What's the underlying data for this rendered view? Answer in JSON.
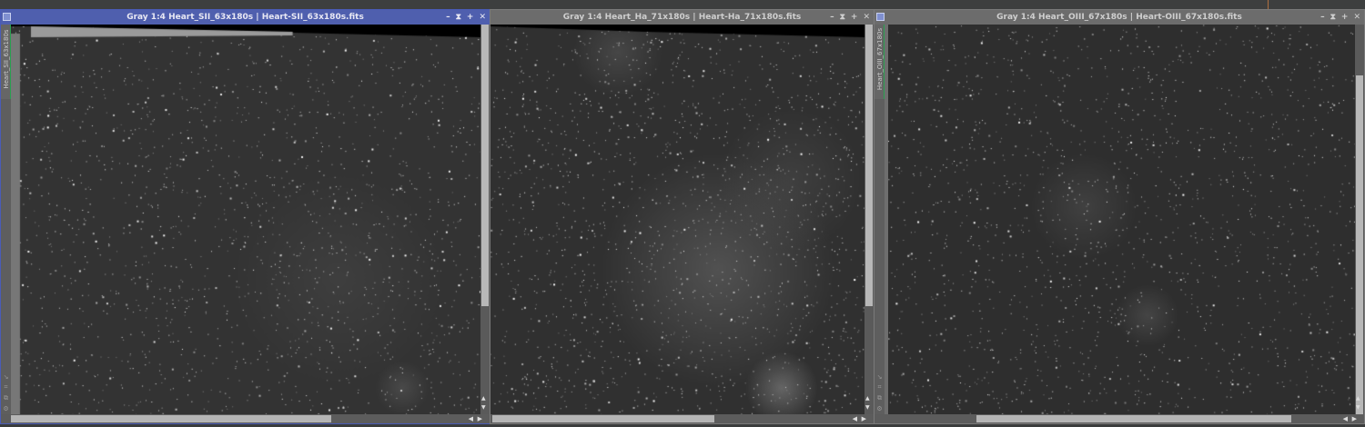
{
  "windows": [
    {
      "title": "Gray 1:4 Heart_SII_63x180s | Heart-SII_63x180s.fits",
      "tab_label": "Heart_SII_63x180s",
      "active": true
    },
    {
      "title": "Gray 1:4 Heart_Ha_71x180s | Heart-Ha_71x180s.fits",
      "tab_label": "",
      "active": false
    },
    {
      "title": "Gray 1:4 Heart_OIII_67x180s | Heart-OIII_67x180s.fits",
      "tab_label": "Heart_OIII_67x180s",
      "active": false
    }
  ],
  "controls": {
    "minimize": "–",
    "shade": "⧗",
    "maximize": "+",
    "close": "✕"
  },
  "colors": {
    "active_title": "#4f5fae",
    "inactive_title": "#6c6c6c",
    "tab_accent": "#2aa050"
  }
}
